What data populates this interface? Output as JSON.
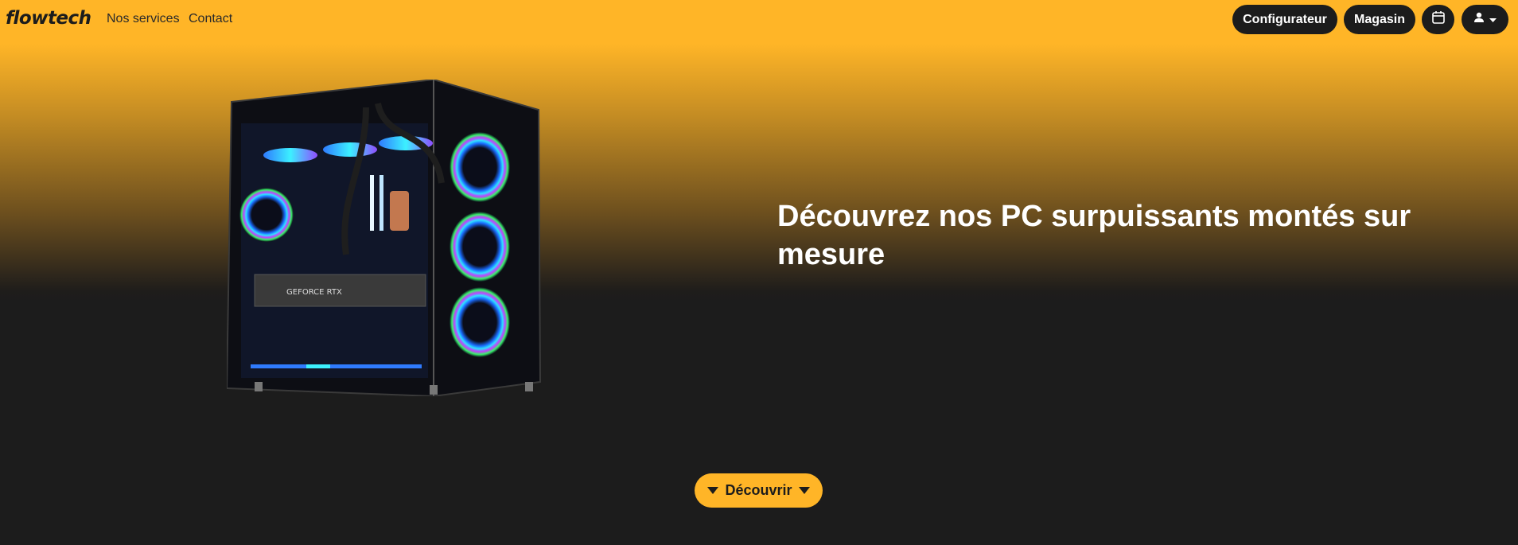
{
  "header": {
    "brand": "flowtech",
    "nav": [
      {
        "label": "Nos services"
      },
      {
        "label": "Contact"
      }
    ],
    "buttons": {
      "configurateur": "Configurateur",
      "magasin": "Magasin",
      "calendar_icon": "calendar-icon",
      "user_icon": "user-icon",
      "user_caret_icon": "caret-down-icon"
    }
  },
  "hero": {
    "image_alt": "PC gaming case with RGB fans",
    "gpu_text": "GEFORCE RTX",
    "heading": "Découvrez nos PC surpuissants montés sur mesure"
  },
  "cta": {
    "label": "Découvrir"
  },
  "colors": {
    "accent": "#ffb527",
    "dark": "#1c1c1c",
    "text_light": "#ffffff"
  }
}
